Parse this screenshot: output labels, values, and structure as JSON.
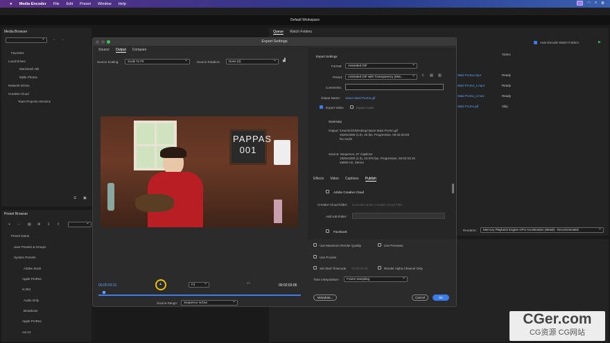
{
  "menubar": {
    "app": "Media Encoder",
    "items": [
      "File",
      "Edit",
      "Preset",
      "Window",
      "Help"
    ]
  },
  "workspace": {
    "title": "Default Workspace"
  },
  "media_browser": {
    "title": "Media Browser",
    "tree": [
      "Favorites",
      "Local Drives",
      "Macintosh HD",
      "Mylie Photos",
      "Network Drives",
      "Creative Cloud",
      "Team Projects Versions"
    ]
  },
  "preset_browser": {
    "title": "Preset Browser",
    "column": "Preset Name",
    "tree": [
      "User Presets & Groups",
      "System Presets",
      "Adobe Stock",
      "Apple ProRes",
      "H.264",
      "Audio Only",
      "Broadcast",
      "Apple ProRes",
      "AS-10"
    ]
  },
  "queue": {
    "tabs": [
      "Queue",
      "Watch Folders"
    ],
    "auto_encode": "Auto-Encode Watch Folders",
    "status_header": "Status",
    "rows": [
      {
        "name": "Masi Promo.mp4",
        "status": "Ready"
      },
      {
        "name": "Masi Promo_1.mp4",
        "status": "Ready"
      },
      {
        "name": "Masi Promo_2.mov",
        "status": "Ready"
      },
      {
        "name": "Masi Promo.gif",
        "status": "Skip"
      }
    ],
    "renderer_label": "Renderer:",
    "renderer_value": "Mercury Playback Engine GPU Acceleration (Metal) - Recommended"
  },
  "dialog": {
    "title": "Export Settings",
    "tabs": [
      "Source",
      "Output",
      "Compare"
    ],
    "source_scaling_label": "Source Scaling:",
    "source_scaling_value": "Scale To Fit",
    "source_rotation_label": "Source Rotation:",
    "source_rotation_value": "None (0)",
    "video_text": "PAPPAS 001",
    "timecode_start": "00:00:03:21",
    "timecode_end": "00:02:03:06",
    "fit_value": "Fit",
    "source_range_label": "Source Range:",
    "source_range_value": "Sequence In/Out",
    "export_settings_title": "Export Settings",
    "format_label": "Format:",
    "format_value": "Animated GIF",
    "preset_label": "Preset:",
    "preset_value": "Animated GIF with Transparency (Mat...",
    "comments_label": "Comments:",
    "output_name_label": "Output Name:",
    "output_name_value": "Jason Masi Promo.gif",
    "export_video": "Export Video",
    "export_audio": "Export Audio",
    "summary_title": "Summary",
    "summary_output": "Output: /Users/rich/Desktop/Jason Masi Promo.gif",
    "summary_output_2": "1920x1080 (1.0), 25 fps, Progressive, 00:02:03:09",
    "summary_output_3": "No Audio",
    "summary_source": "Source: Sequence, 07 Captions",
    "summary_source_2": "1920x1080 (1.0), 23.976 fps, Progressive, 00:02:03:15",
    "summary_source_3": "48000 Hz, Stereo",
    "lower_tabs": [
      "Effects",
      "Video",
      "Captions",
      "Publish"
    ],
    "adobe_cc": "Adobe Creative Cloud",
    "cc_folder_label": "Creative Cloud folder:",
    "cc_folder_value": "Console/Adobe Creative Cloud Files",
    "add_subfolder_label": "Add sub-folder:",
    "facebook": "Facebook",
    "max_render": "Use Maximum Render Quality",
    "use_previews": "Use Previews",
    "use_proxies": "Use Proxies",
    "set_start_tc": "Set Start Timecode",
    "start_tc_value": "00:00:00:00",
    "render_alpha": "Render Alpha Channel Only",
    "time_interp_label": "Time Interpolation:",
    "time_interp_value": "Frame Sampling",
    "metadata_btn": "Metadata...",
    "cancel_btn": "Cancel",
    "ok_btn": "OK"
  },
  "watermark": {
    "big": "CGer.com",
    "small": "CG资源 CG网站"
  },
  "colors": {
    "accent": "#3b7ce8",
    "link": "#5ea3ff",
    "menubar": "#4a2e85"
  }
}
